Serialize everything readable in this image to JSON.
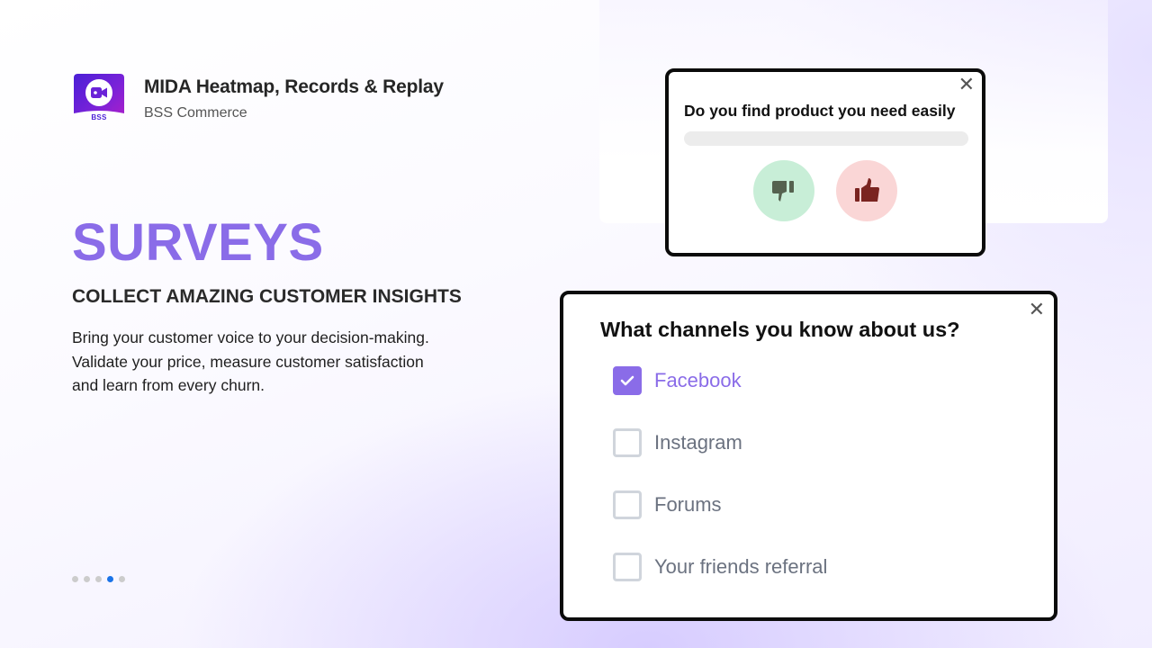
{
  "app": {
    "title": "MIDA Heatmap, Records & Replay",
    "vendor": "BSS Commerce",
    "logo_icon": "video-camera-icon",
    "logo_text": "BSS"
  },
  "hero": {
    "title": "SURVEYS",
    "subtitle": "COLLECT AMAZING CUSTOMER INSIGHTS",
    "description_lines": [
      "Bring your customer voice to your decision-making.",
      "Validate your price, measure customer satisfaction",
      "and learn from every churn."
    ]
  },
  "pager": {
    "total": 5,
    "active_index": 3
  },
  "survey_rating": {
    "question": "Do you find product you need easily",
    "close_icon": "✕",
    "progress": 0,
    "buttons": [
      {
        "name": "thumbs-down",
        "icon": "thumbs-down-icon",
        "bg": "#c8eed7",
        "fg": "#55624f"
      },
      {
        "name": "thumbs-up",
        "icon": "thumbs-up-icon",
        "bg": "#fad6d6",
        "fg": "#7a2420"
      }
    ]
  },
  "survey_channels": {
    "question": "What channels you know about us?",
    "close_icon": "✕",
    "options": [
      {
        "label": "Facebook",
        "checked": true
      },
      {
        "label": "Instagram",
        "checked": false
      },
      {
        "label": "Forums",
        "checked": false
      },
      {
        "label": "Your friends referral",
        "checked": false
      }
    ]
  },
  "colors": {
    "accent": "#8a6ce8",
    "pager_active": "#1a73e8",
    "pager_inactive": "#cccccc",
    "card_border": "#0b0b0b"
  }
}
